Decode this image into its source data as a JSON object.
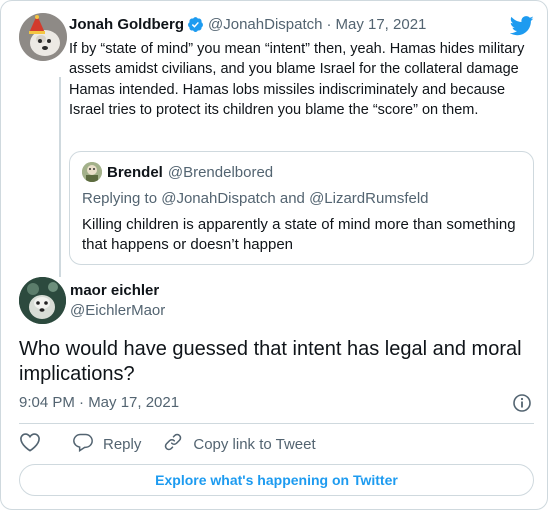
{
  "parent_tweet": {
    "author_name": "Jonah Goldberg",
    "handle": "@JonahDispatch",
    "separator": "·",
    "date": "May 17, 2021",
    "text": "If by “state of mind” you mean “intent” then, yeah. Hamas hides military assets amidst civilians, and you blame Israel for the collateral damage Hamas intended. Hamas lobs missiles indiscriminately and because Israel tries to protect its children you blame the “score” on them."
  },
  "quoted_tweet": {
    "author_name": "Brendel",
    "handle": "@Brendelbored",
    "replying_prefix": "Replying to",
    "replying_to_1": "@JonahDispatch",
    "replying_and": "and",
    "replying_to_2": "@LizardRumsfeld",
    "text": "Killing children is apparently a state of mind more than something that happens or doesn’t happen"
  },
  "main_tweet": {
    "author_name": "maor eichler",
    "handle": "@EichlerMaor",
    "text": "Who would have guessed that intent has legal and moral implications?",
    "timestamp": "9:04 PM · May 17, 2021"
  },
  "actions": {
    "reply_label": "Reply",
    "copy_link_label": "Copy link to Tweet"
  },
  "footer": {
    "explore_label": "Explore what's happening on Twitter"
  },
  "icons": {
    "brand": "twitter-bird-icon",
    "verified": "verified-badge-icon",
    "info": "info-icon",
    "like": "heart-icon",
    "reply": "speech-bubble-icon",
    "copy_link": "link-icon"
  },
  "colors": {
    "accent": "#1d9bf0",
    "text": "#0f1419",
    "secondary_text": "#536471",
    "border": "#cfd9de"
  }
}
